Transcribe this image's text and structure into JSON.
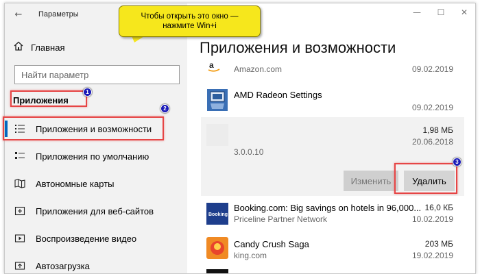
{
  "window": {
    "title": "Параметры",
    "back_glyph": "←",
    "minimize_glyph": "—",
    "maximize_glyph": "☐",
    "close_glyph": "✕"
  },
  "callout": {
    "line1": "Чтобы открыть это окно —",
    "line2": "нажмите Win+i"
  },
  "sidebar": {
    "home_label": "Главная",
    "search_placeholder": "Найти параметр",
    "section_title": "Приложения",
    "items": [
      {
        "label": "Приложения и возможности",
        "icon": "apps-list-icon",
        "active": true
      },
      {
        "label": "Приложения по умолчанию",
        "icon": "default-apps-icon"
      },
      {
        "label": "Автономные карты",
        "icon": "offline-maps-icon"
      },
      {
        "label": "Приложения для веб-сайтов",
        "icon": "web-apps-icon"
      },
      {
        "label": "Воспроизведение видео",
        "icon": "video-playback-icon"
      },
      {
        "label": "Автозагрузка",
        "icon": "startup-icon"
      }
    ]
  },
  "badges": [
    "1",
    "2",
    "3"
  ],
  "main": {
    "title": "Приложения и возможности",
    "apps": [
      {
        "name": "",
        "publisher": "Amazon.com",
        "size": "",
        "date": "09.02.2019",
        "icon": "amazon-icon"
      },
      {
        "name": "AMD Radeon Settings",
        "publisher": "",
        "size": "",
        "date": "09.02.2019",
        "icon": "amd-radeon-icon"
      },
      {
        "name": "",
        "publisher": "",
        "size": "1,98 МБ",
        "date": "20.06.2018",
        "version": "3.0.0.10",
        "icon": "blurred-app-icon"
      },
      {
        "name": "Booking.com: Big savings on hotels in 96,000...",
        "publisher": "Priceline Partner Network",
        "size": "16,0 КБ",
        "date": "10.02.2019",
        "icon": "booking-icon"
      },
      {
        "name": "Candy Crush Saga",
        "publisher": "king.com",
        "size": "203 МБ",
        "date": "19.02.2019",
        "icon": "candy-crush-icon"
      }
    ],
    "change_button": "Изменить",
    "delete_button": "Удалить"
  },
  "colors": {
    "accent": "#0067c0",
    "highlight": "#e64545",
    "callout": "#f6e71c",
    "badge": "#1a1ab8"
  }
}
